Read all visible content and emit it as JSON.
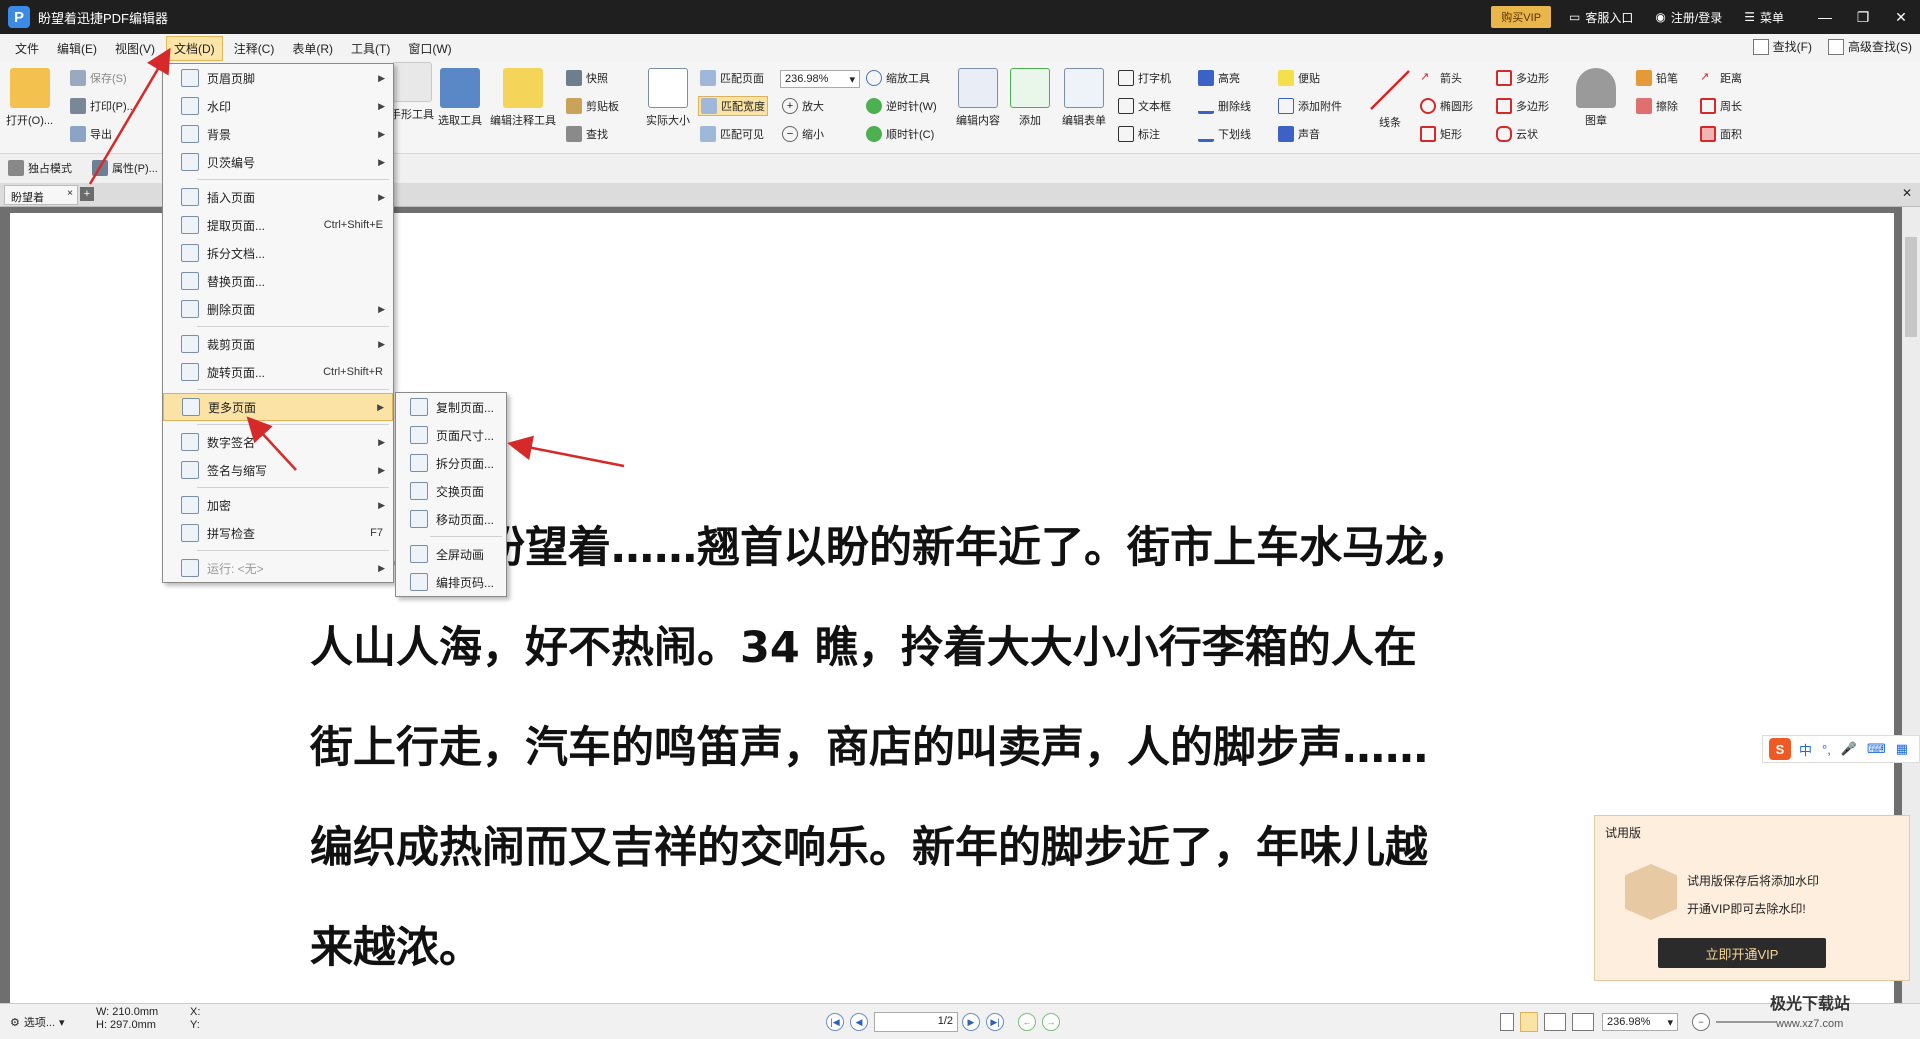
{
  "app": {
    "title": "盼望着迅捷PDF编辑器",
    "vip_button": "购买VIP",
    "service": "客服入口",
    "login": "注册/登录",
    "menu": "菜单"
  },
  "menubar": {
    "items": [
      "文件",
      "编辑(E)",
      "视图(V)",
      "文档(D)",
      "注释(C)",
      "表单(R)",
      "工具(T)",
      "窗口(W)"
    ],
    "find": "查找(F)",
    "advanced_find": "高级查找(S)"
  },
  "ribbon": {
    "open": "打开(O)...",
    "save": "保存(S)",
    "print": "打印(P)...",
    "export": "导出",
    "exclusive_mode": "独占模式",
    "properties": "属性(P)...",
    "hand_tool": "手形工具",
    "select_tool": "选取工具",
    "edit_annot_tool": "编辑注释工具",
    "snapshot": "快照",
    "clipboard": "剪贴板",
    "find": "查找",
    "actual_size": "实际大小",
    "fit_page": "匹配页面",
    "fit_width": "匹配宽度",
    "fit_visible": "匹配可见",
    "zoom_value": "236.98%",
    "zoom_in": "放大",
    "zoom_out": "缩小",
    "zoom_tool": "缩放工具",
    "rotate_ccw": "逆时针(W)",
    "rotate_cw": "顺时针(C)",
    "edit_content": "编辑内容",
    "add": "添加",
    "edit_form": "编辑表单",
    "typewriter": "打字机",
    "textbox": "文本框",
    "callout": "标注",
    "highlight": "高亮",
    "strikeout": "删除线",
    "underline": "下划线",
    "note": "便贴",
    "attach": "添加附件",
    "sound": "声音",
    "line": "线条",
    "arrow": "箭头",
    "ellipse": "椭圆形",
    "rectangle": "矩形",
    "polygon": "多边形",
    "polyline": "多边形",
    "cloud": "云状",
    "stamp": "图章",
    "pencil": "铅笔",
    "eraser": "擦除",
    "distance": "距离",
    "perimeter": "周长",
    "area": "面积"
  },
  "tab": {
    "name": "盼望着",
    "close": "×",
    "add": "+"
  },
  "doc_menu": {
    "items": [
      {
        "label": "页眉页脚",
        "arrow": true
      },
      {
        "label": "水印",
        "arrow": true
      },
      {
        "label": "背景",
        "arrow": true
      },
      {
        "label": "贝茨编号",
        "arrow": true
      },
      {
        "sep": true
      },
      {
        "label": "插入页面",
        "arrow": true
      },
      {
        "label": "提取页面...",
        "shortcut": "Ctrl+Shift+E"
      },
      {
        "label": "拆分文档..."
      },
      {
        "label": "替换页面..."
      },
      {
        "label": "删除页面",
        "arrow": true
      },
      {
        "sep": true
      },
      {
        "label": "裁剪页面",
        "arrow": true
      },
      {
        "label": "旋转页面...",
        "shortcut": "Ctrl+Shift+R"
      },
      {
        "sep": true
      },
      {
        "label": "更多页面",
        "arrow": true,
        "highlight": true
      },
      {
        "sep": true
      },
      {
        "label": "数字签名",
        "arrow": true
      },
      {
        "label": "签名与缩写",
        "arrow": true
      },
      {
        "sep": true
      },
      {
        "label": "加密",
        "arrow": true
      },
      {
        "label": "拼写检查",
        "shortcut": "F7"
      },
      {
        "sep": true
      },
      {
        "label": "运行: <无>",
        "arrow": true,
        "disabled": true
      }
    ]
  },
  "more_pages_menu": {
    "items": [
      {
        "label": "复制页面..."
      },
      {
        "label": "页面尺寸..."
      },
      {
        "label": "拆分页面..."
      },
      {
        "label": "交换页面"
      },
      {
        "label": "移动页面..."
      },
      {
        "sep": true
      },
      {
        "label": "全屏动画"
      },
      {
        "label": "编排页码..."
      }
    ]
  },
  "document": {
    "lines": [
      "盼望着，盼望着……翘首以盼的新年近了。街市上车水马龙，",
      "人山人海，好不热闹。34 瞧，拎着大大小小行李箱的人在",
      "街上行走，汽车的鸣笛声，商店的叫卖声，人的脚步声……",
      "编织成热闹而又吉祥的交响乐。新年的脚步近了，年味儿越",
      "来越浓。"
    ]
  },
  "status": {
    "options": "选项...",
    "width": "W: 210.0mm",
    "height": "H: 297.0mm",
    "x": "X:",
    "y": "Y:",
    "page": "1",
    "page_total": "/2",
    "zoom": "236.98%"
  },
  "trial": {
    "title": "试用版",
    "line1": "试用版保存后将添加水印",
    "line2": "开通VIP即可去除水印!",
    "button": "立即开通VIP"
  },
  "ime": {
    "logo": "S",
    "lang": "中",
    "punct": "°,"
  },
  "watermark": {
    "name": "极光下载站",
    "url": "www.xz7.com"
  },
  "colors": {
    "accent_highlight": "#fbe3a5",
    "titlebar": "#1f1f1f",
    "vip": "#e8b64a",
    "annotation_arrow": "#d62a2a"
  }
}
